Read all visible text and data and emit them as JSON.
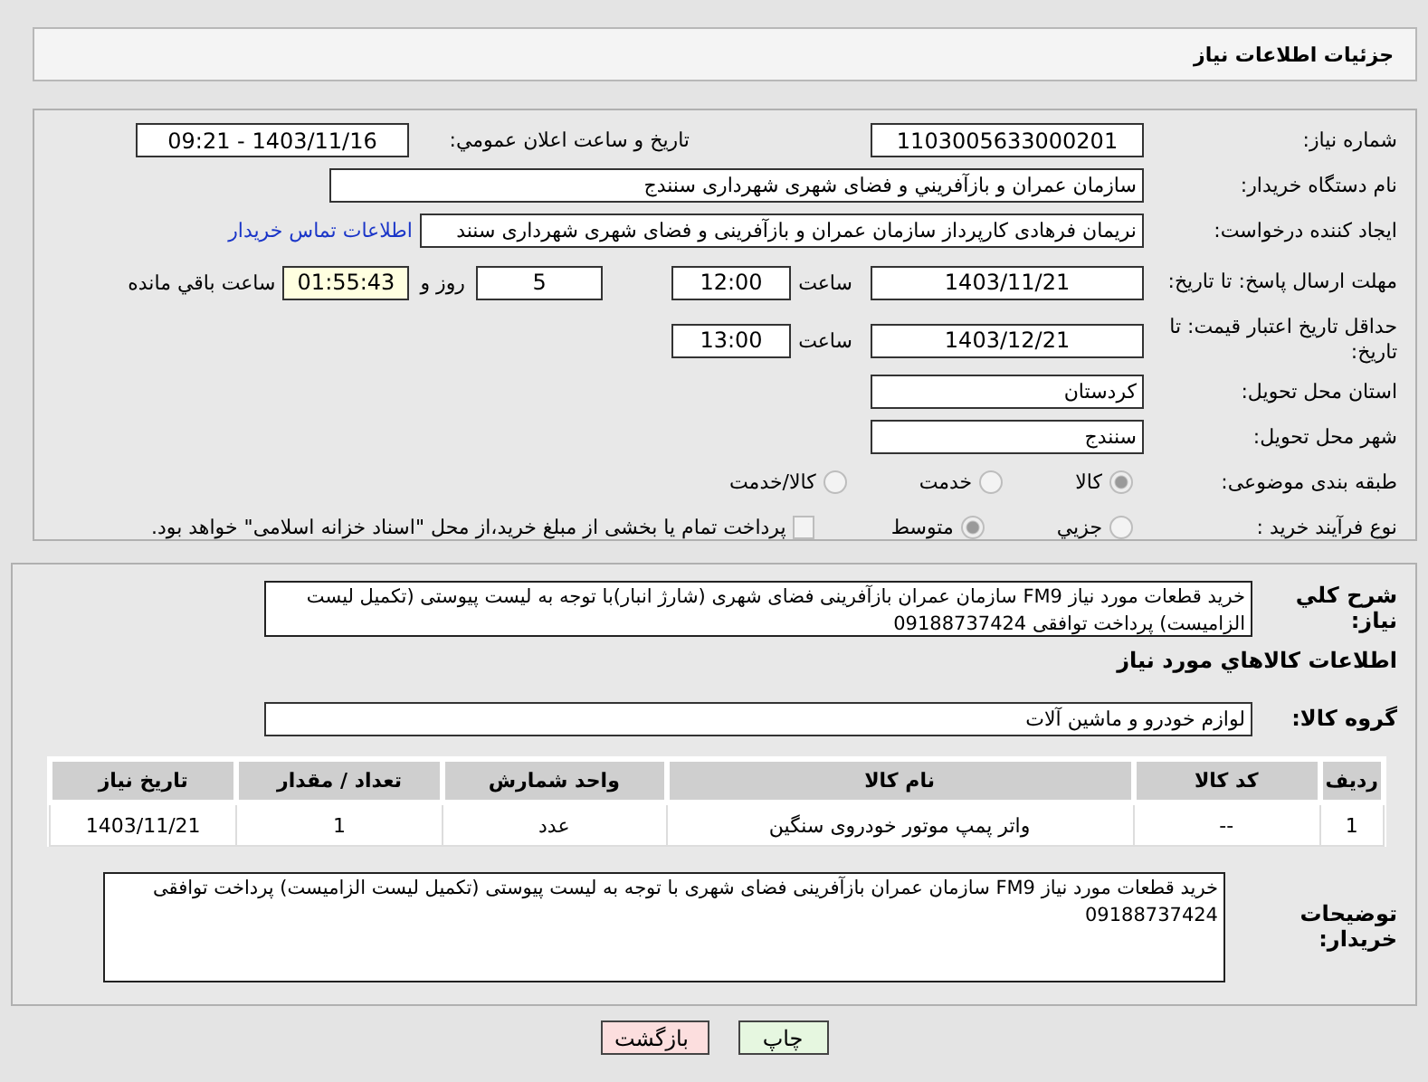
{
  "header": {
    "title": "جزئیات اطلاعات نیاز"
  },
  "need_number": {
    "label": "شماره نیاز:",
    "value": "1103005633000201"
  },
  "announce": {
    "label": "تاريخ و ساعت اعلان عمومي:",
    "value": "1403/11/16 - 09:21"
  },
  "buyer": {
    "label": "نام دستگاه خريدار:",
    "value": "سازمان عمران و بازآفريني و فضای شهری شهرداری سنندج"
  },
  "creator": {
    "label": "ايجاد كننده درخواست:",
    "value": "نریمان فرهادی کارپرداز سازمان عمران و بازآفرینی و فضای شهری شهرداری سنند",
    "link": "اطلاعات تماس خريدار"
  },
  "deadline": {
    "label": "مهلت ارسال پاسخ: تا تاریخ:",
    "date": "1403/11/21",
    "time_label": "ساعت",
    "time": "12:00",
    "days": "5",
    "days_label": "روز و",
    "remaining": "01:55:43",
    "remaining_label": "ساعت باقي مانده"
  },
  "validity": {
    "label": "حداقل تاريخ اعتبار قيمت: تا تاريخ:",
    "date": "1403/12/21",
    "time_label": "ساعت",
    "time": "13:00"
  },
  "province": {
    "label": "استان محل تحويل:",
    "value": "کردستان"
  },
  "city": {
    "label": "شهر محل تحويل:",
    "value": "سنندج"
  },
  "category": {
    "label": "طبقه بندی موضوعی:",
    "options": [
      {
        "label": "كالا",
        "selected": true
      },
      {
        "label": "خدمت",
        "selected": false
      },
      {
        "label": "كالا/خدمت",
        "selected": false
      }
    ]
  },
  "process": {
    "label": "نوع فرآيند خريد :",
    "options": [
      {
        "label": "جزيي",
        "selected": false
      },
      {
        "label": "متوسط",
        "selected": true
      }
    ],
    "treasury": {
      "label": "پرداخت تمام يا بخشی از مبلغ خرید،از محل \"اسناد خزانه اسلامی\" خواهد بود.",
      "checked": false
    }
  },
  "summary": {
    "label": "شرح كلي نياز:",
    "value": "خرید قطعات مورد نیاز FM9 سازمان عمران بازآفرینی فضای شهری (شارژ انبار)با توجه به لیست پیوستی (تکمیل لیست الزامیست) پرداخت توافقی 09188737424"
  },
  "goods_heading": "اطلاعات كالاهاي مورد نياز",
  "goods_group": {
    "label": "گروه كالا:",
    "value": "لوازم خودرو و ماشين آلات"
  },
  "table": {
    "columns": [
      "رديف",
      "كد كالا",
      "نام كالا",
      "واحد شمارش",
      "تعداد / مقدار",
      "تاريخ نياز"
    ],
    "rows": [
      [
        "1",
        "--",
        "واتر پمپ موتور خودروی سنگین",
        "عدد",
        "1",
        "1403/11/21"
      ]
    ]
  },
  "buyer_notes": {
    "label": "توضيحات خريدار:",
    "value": "خرید قطعات مورد نیاز FM9 سازمان عمران بازآفرینی فضای شهری با توجه به لیست پیوستی (تکمیل لیست الزامیست) پرداخت توافقی 09188737424"
  },
  "buttons": [
    {
      "label": "چاپ",
      "kind": "print"
    },
    {
      "label": "بازگشت",
      "kind": "back"
    }
  ]
}
